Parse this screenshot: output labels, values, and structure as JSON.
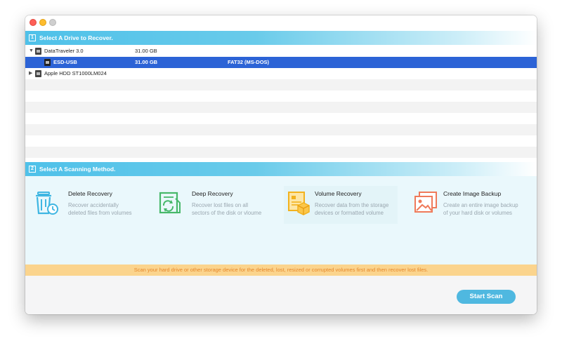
{
  "step1": {
    "number": "1",
    "title": "Select A Drive to Recover."
  },
  "drives": [
    {
      "name": "DataTraveler 3.0",
      "size": "31.00 GB",
      "fs": "",
      "expanded": true
    },
    {
      "name": "ESD-USB",
      "size": "31.00 GB",
      "fs": "FAT32 (MS-DOS)",
      "selected": true
    },
    {
      "name": "Apple HDD ST1000LM024",
      "size": "",
      "fs": "",
      "expanded": false
    }
  ],
  "step2": {
    "number": "2",
    "title": "Select A Scanning Method."
  },
  "methods": [
    {
      "title": "Delete Recovery",
      "desc1": "Recover accidentally",
      "desc2": "deleted files from volumes",
      "icon": "trash-clock-icon"
    },
    {
      "title": "Deep Recovery",
      "desc1": "Recover lost files on all",
      "desc2": "sectors of the disk or vloume",
      "icon": "document-recycle-icon"
    },
    {
      "title": "Volume Recovery",
      "desc1": "Recover data from the storage",
      "desc2": "devices or formatted volume",
      "icon": "volume-box-icon",
      "active": true
    },
    {
      "title": "Create Image Backup",
      "desc1": "Create an entire image backup",
      "desc2": "of your hard disk or volumes",
      "icon": "image-backup-icon"
    }
  ],
  "notice": "Scan your hard drive or other storage device for the deleted, lost, resized or corrupted volumes first and then recover lost files.",
  "start_button": "Start Scan",
  "colors": {
    "accent": "#4fc1e9",
    "selection": "#2c63d6",
    "notice_bg": "#fbd48d",
    "notice_text": "#e6872a",
    "button": "#4fb8e0"
  }
}
